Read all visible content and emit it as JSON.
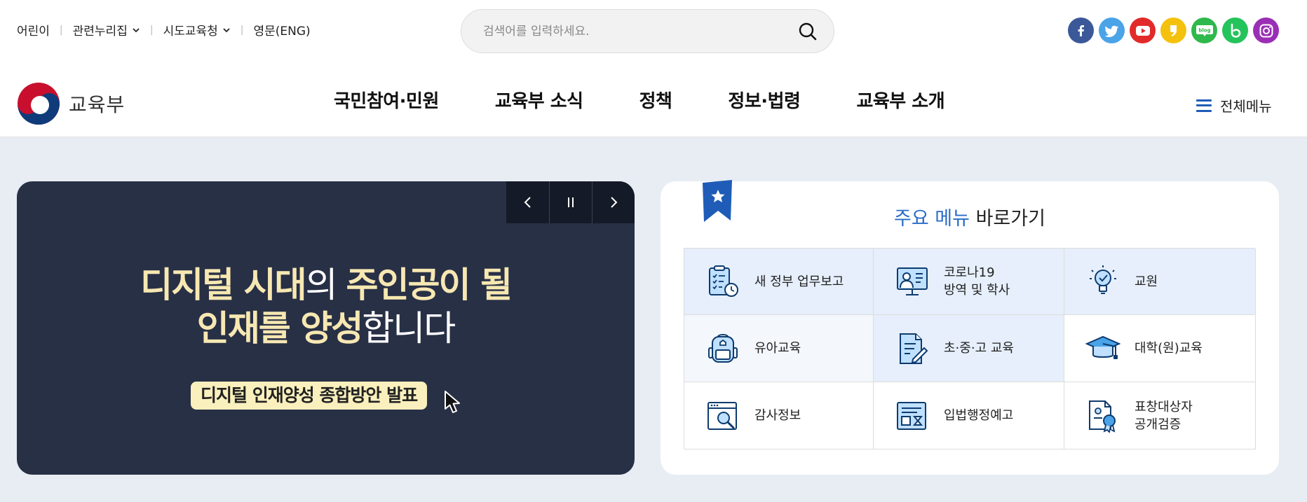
{
  "util": {
    "links": [
      {
        "label": "어린이"
      },
      {
        "label": "관련누리집"
      },
      {
        "label": "시도교육청"
      },
      {
        "label": "영문(ENG)"
      }
    ]
  },
  "search": {
    "placeholder": "검색어를 입력하세요."
  },
  "sns": [
    {
      "icon": "facebook-icon",
      "glyph": "f",
      "color": "#3b5998"
    },
    {
      "icon": "twitter-icon",
      "glyph": "",
      "color": "#4ba3e8"
    },
    {
      "icon": "youtube-icon",
      "glyph": "",
      "color": "#e22a2a"
    },
    {
      "icon": "kakao-story-icon",
      "glyph": "",
      "color": "#f4c20d"
    },
    {
      "icon": "blog-icon",
      "glyph": "blog",
      "color": "#2fb84b"
    },
    {
      "icon": "band-icon",
      "glyph": "b",
      "color": "#25c35b"
    },
    {
      "icon": "instagram-icon",
      "glyph": "",
      "color": "#9a2fb5"
    }
  ],
  "header": {
    "logo_text": "교육부",
    "nav": [
      "국민참여·민원",
      "교육부 소식",
      "정책",
      "정보·법령",
      "교육부 소개"
    ],
    "all_menu": "전체메뉴"
  },
  "banner": {
    "line1_a": "디지털 시대",
    "line1_b": "의 ",
    "line1_c": "주인공이 될",
    "line2_a": "인재를 양성",
    "line2_b": "합니다",
    "pill": "디지털 인재양성 종합방안 발표"
  },
  "quick": {
    "title_hl": "주요 메뉴",
    "title_rest": " 바로가기",
    "items": [
      {
        "label": "새 정부 업무보고",
        "icon": "report-clipboard-icon"
      },
      {
        "label": "코로나19\n방역 및 학사",
        "icon": "monitor-teacher-icon"
      },
      {
        "label": "교원",
        "icon": "lightbulb-icon"
      },
      {
        "label": "유아교육",
        "icon": "backpack-icon"
      },
      {
        "label": "초·중·고 교육",
        "icon": "document-pencil-icon"
      },
      {
        "label": "대학(원)교육",
        "icon": "graduation-cap-icon"
      },
      {
        "label": "감사정보",
        "icon": "magnifier-window-icon"
      },
      {
        "label": "입법행정예고",
        "icon": "legislation-icon"
      },
      {
        "label": "표창대상자\n공개검증",
        "icon": "award-document-icon"
      }
    ]
  },
  "colors": {
    "accent": "#2a6cc7",
    "banner_bg": "#283046",
    "banner_highlight": "#f7e8b2",
    "main_bg": "#e8edf4"
  }
}
